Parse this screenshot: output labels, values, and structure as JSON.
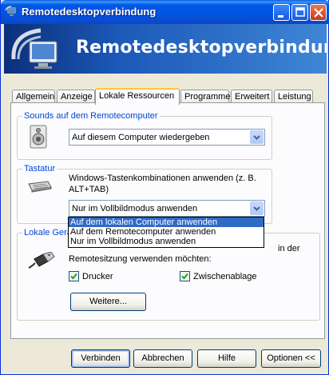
{
  "window": {
    "title": "Remotedesktopverbindung"
  },
  "banner": {
    "title": "Remotedesktopverbindung"
  },
  "tabs": [
    {
      "label": "Allgemein"
    },
    {
      "label": "Anzeige"
    },
    {
      "label": "Lokale Ressourcen",
      "active": true
    },
    {
      "label": "Programme"
    },
    {
      "label": "Erweitert"
    },
    {
      "label": "Leistung"
    }
  ],
  "sounds": {
    "title": "Sounds auf dem Remotecomputer",
    "selected": "Auf diesem Computer wiedergeben"
  },
  "keyboard": {
    "title": "Tastatur",
    "description_line1": "Windows-Tastenkombinationen anwenden (z. B.",
    "description_line2": "ALT+TAB)",
    "selected": "Nur im Vollbildmodus anwenden",
    "options": [
      "Auf dem lokalen Computer anwenden",
      "Auf dem Remotecomputer anwenden",
      "Nur im Vollbildmodus anwenden"
    ],
    "highlighted_index": 0
  },
  "local_devices": {
    "title": "Lokale Gerä",
    "desc_tail": "in der",
    "desc_line2": "Remotesitzung verwenden möchten:",
    "printer_label": "Drucker",
    "printer_checked": true,
    "clipboard_label": "Zwischenablage",
    "clipboard_checked": true,
    "more_button": "Weitere..."
  },
  "footer": {
    "connect": "Verbinden",
    "cancel": "Abbrechen",
    "help": "Hilfe",
    "options": "Optionen <<"
  },
  "colors": {
    "titlebar": "#0054e3",
    "group_title": "#0046d5",
    "selection": "#316ac5",
    "check": "#21a121"
  }
}
